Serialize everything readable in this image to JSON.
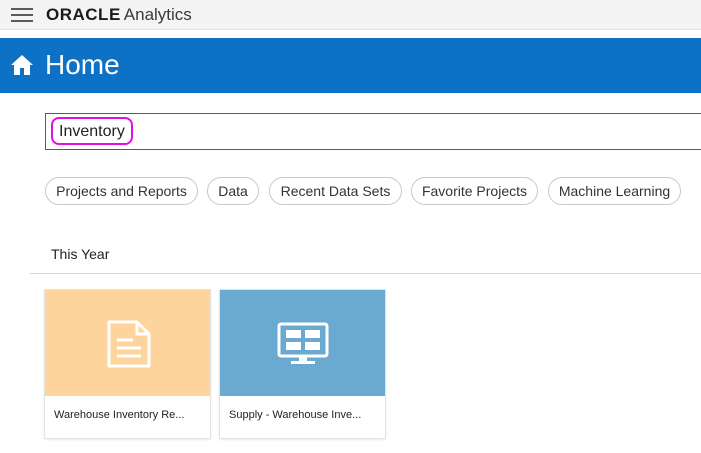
{
  "brand": {
    "oracle": "ORACLE",
    "product": "Analytics"
  },
  "header": {
    "title": "Home"
  },
  "search": {
    "value": "Inventory"
  },
  "chips": [
    {
      "label": "Projects and Reports"
    },
    {
      "label": "Data"
    },
    {
      "label": "Recent Data Sets"
    },
    {
      "label": "Favorite Projects"
    },
    {
      "label": "Machine Learning"
    }
  ],
  "section": {
    "title": "This Year"
  },
  "cards": [
    {
      "label": "Warehouse Inventory Re...",
      "thumb_color": "#fdd59c",
      "icon": "document-icon"
    },
    {
      "label": "Supply - Warehouse Inve...",
      "thumb_color": "#6aaad0",
      "icon": "dashboard-monitor-icon"
    }
  ],
  "colors": {
    "header_bg": "#0d72c6",
    "highlight": "#e20ee6",
    "search_border": "#0c7a96"
  }
}
